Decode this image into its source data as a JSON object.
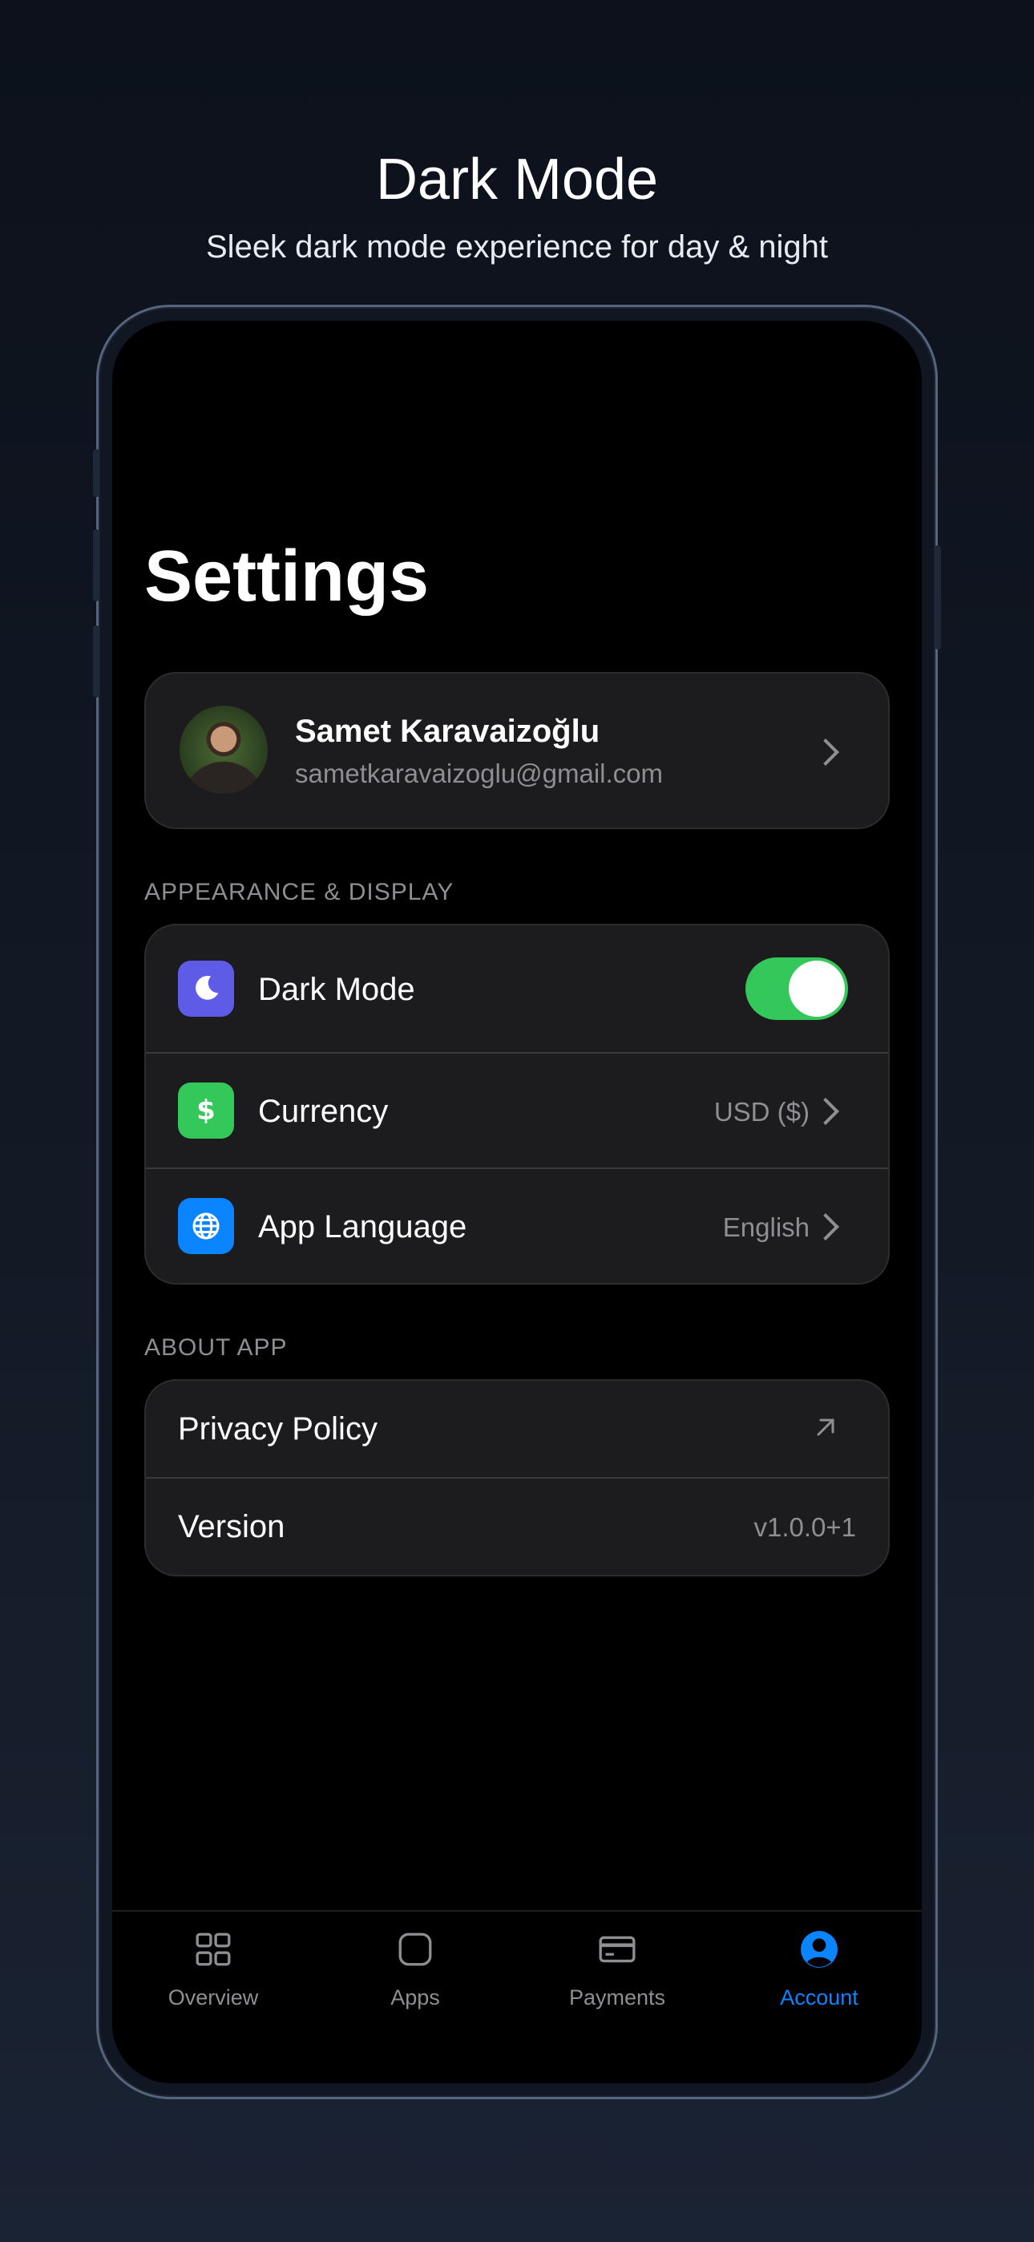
{
  "hero": {
    "title": "Dark Mode",
    "subtitle": "Sleek dark mode experience for day & night"
  },
  "screen": {
    "title": "Settings",
    "profile": {
      "name": "Samet Karavaizoğlu",
      "email": "sametkaravaizoglu@gmail.com"
    },
    "sections": [
      {
        "label": "APPEARANCE & DISPLAY",
        "items": [
          {
            "label": "Dark Mode",
            "icon": "moon-icon",
            "icon_color": "#5e5ce6",
            "toggle_on": true
          },
          {
            "label": "Currency",
            "icon": "dollar-icon",
            "icon_color": "#34c759",
            "value": "USD ($)"
          },
          {
            "label": "App Language",
            "icon": "globe-icon",
            "icon_color": "#0a84ff",
            "value": "English"
          }
        ]
      },
      {
        "label": "ABOUT APP",
        "items": [
          {
            "label": "Privacy Policy",
            "icon": "external-link-icon"
          },
          {
            "label": "Version",
            "value": "v1.0.0+1"
          }
        ]
      }
    ],
    "tabbar": [
      {
        "label": "Overview",
        "icon": "grid-icon",
        "active": false
      },
      {
        "label": "Apps",
        "icon": "square-icon",
        "active": false
      },
      {
        "label": "Payments",
        "icon": "card-icon",
        "active": false
      },
      {
        "label": "Account",
        "icon": "account-icon",
        "active": true
      }
    ]
  },
  "colors": {
    "accent": "#0a84ff",
    "toggle_on": "#34c759",
    "card_bg": "#1c1c1e",
    "secondary_text": "#8e8e93"
  }
}
